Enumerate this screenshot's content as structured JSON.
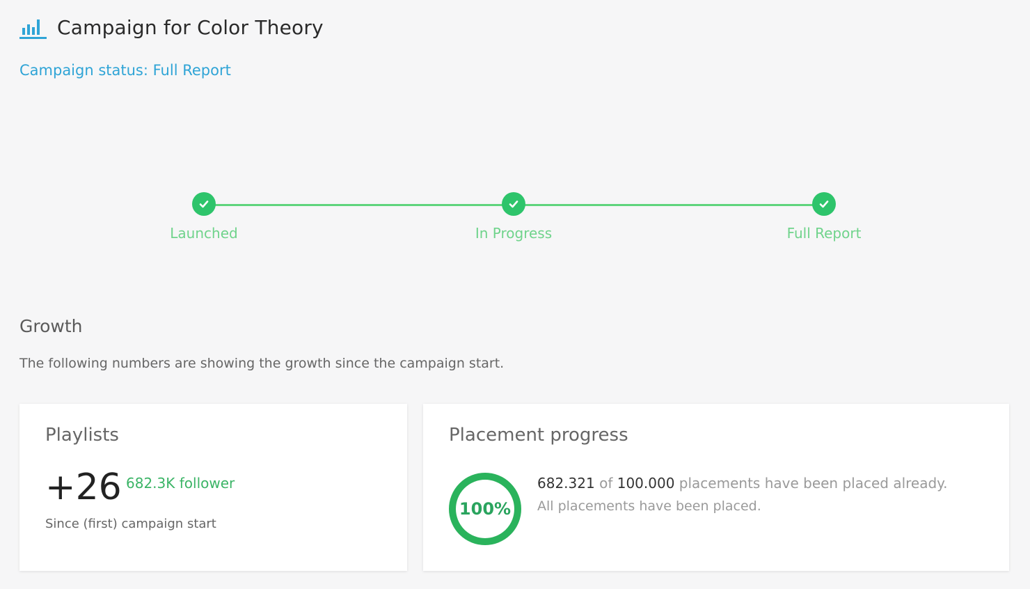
{
  "header": {
    "title": "Campaign for Color Theory",
    "icon": "bar-chart-icon",
    "status_link": "Campaign status: Full Report"
  },
  "stepper": {
    "steps": [
      {
        "label": "Launched",
        "done": true
      },
      {
        "label": "In Progress",
        "done": true
      },
      {
        "label": "Full Report",
        "done": true
      }
    ],
    "color": "#2ec46b"
  },
  "growth": {
    "title": "Growth",
    "description": "The following numbers are showing the growth since the campaign start."
  },
  "playlists_card": {
    "title": "Playlists",
    "value": "+26",
    "follower": "682.3K follower",
    "since": "Since (first) campaign start"
  },
  "placement_card": {
    "title": "Placement progress",
    "percent_label": "100%",
    "progress": 1.0,
    "placed": "682.321",
    "of_word": "of",
    "total": "100.000",
    "suffix": "placements have been placed already.",
    "status": "All placements have been placed."
  }
}
